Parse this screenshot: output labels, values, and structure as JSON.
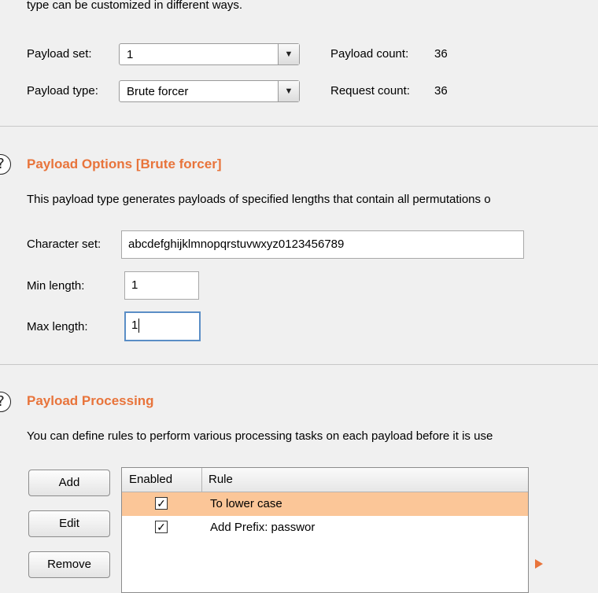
{
  "intro_text": "type can be customized in different ways.",
  "payload_set": {
    "label": "Payload set:",
    "value": "1",
    "count_label": "Payload count:",
    "count_value": "36"
  },
  "payload_type": {
    "label": "Payload type:",
    "value": "Brute forcer",
    "count_label": "Request count:",
    "count_value": "36"
  },
  "options": {
    "title": "Payload Options [Brute forcer]",
    "description": "This payload type generates payloads of specified lengths that contain all permutations o",
    "charset_label": "Character set:",
    "charset_value": "abcdefghijklmnopqrstuvwxyz0123456789",
    "min_label": "Min length:",
    "min_value": "1",
    "max_label": "Max length:",
    "max_value": "1"
  },
  "processing": {
    "title": "Payload Processing",
    "description": "You can define rules to perform various processing tasks on each payload before it is use",
    "buttons": {
      "add": "Add",
      "edit": "Edit",
      "remove": "Remove"
    },
    "columns": {
      "enabled": "Enabled",
      "rule": "Rule"
    },
    "rows": [
      {
        "enabled_mark": "✓",
        "rule": "To lower case"
      },
      {
        "enabled_mark": "✓",
        "rule": "Add Prefix: passwor"
      }
    ]
  },
  "icons": {
    "help": "?",
    "dropdown": "▼"
  },
  "colors": {
    "accent": "#e8743b",
    "selected_row": "#fbc698",
    "focus_border": "#5a8ec6"
  }
}
